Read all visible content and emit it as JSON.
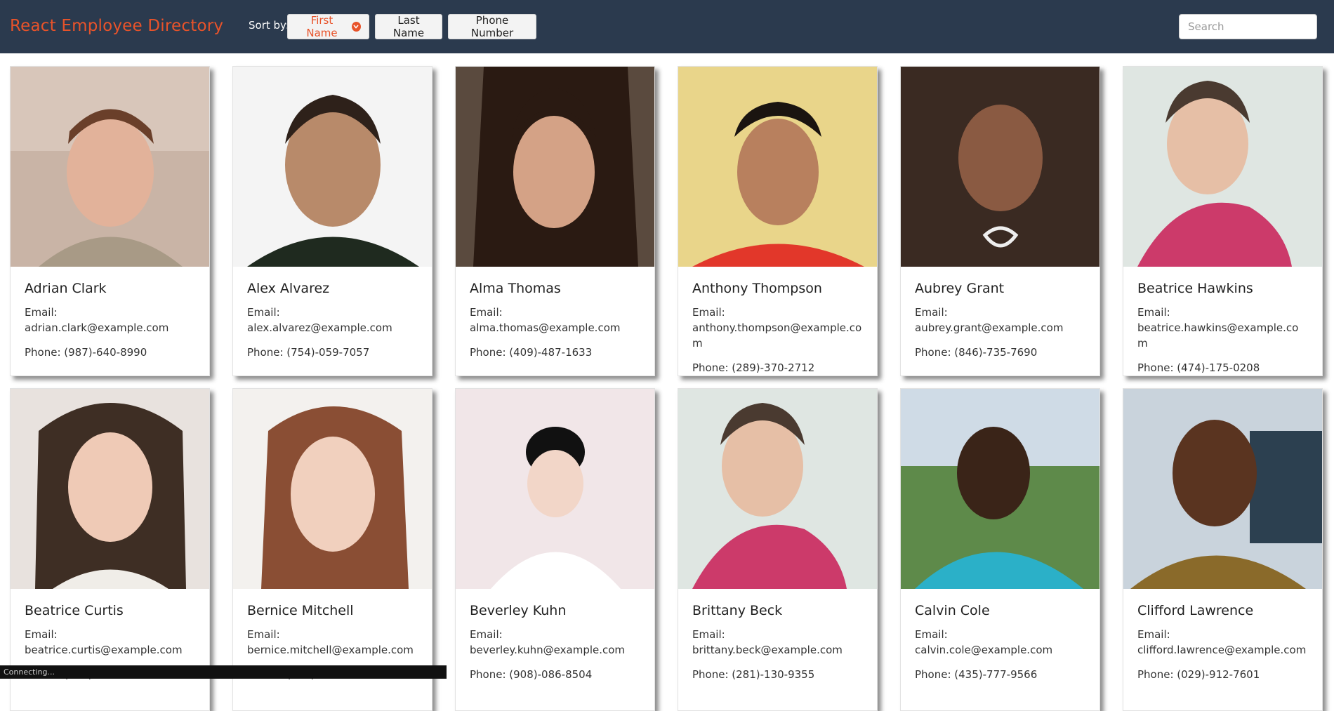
{
  "app": {
    "title": "React Employee Directory"
  },
  "sort": {
    "label": "Sort by:",
    "options": [
      "First Name",
      "Last Name",
      "Phone Number"
    ],
    "active": "First Name"
  },
  "search": {
    "placeholder": "Search",
    "value": ""
  },
  "labels": {
    "email_prefix": "Email:",
    "phone_prefix": "Phone:"
  },
  "colors": {
    "header_bg": "#2b3a4e",
    "accent": "#e8532a"
  },
  "employees": [
    {
      "name": "Adrian Clark",
      "email": "Email: adrian.clark@example.com",
      "phone": "Phone: (987)-640-8990"
    },
    {
      "name": "Alex Alvarez",
      "email": "Email: alex.alvarez@example.com",
      "phone": "Phone: (754)-059-7057"
    },
    {
      "name": "Alma Thomas",
      "email": "Email: alma.thomas@example.com",
      "phone": "Phone: (409)-487-1633"
    },
    {
      "name": "Anthony Thompson",
      "email": "Email: anthony.thompson@example.com",
      "phone": "Phone: (289)-370-2712"
    },
    {
      "name": "Aubrey Grant",
      "email": "Email: aubrey.grant@example.com",
      "phone": "Phone: (846)-735-7690"
    },
    {
      "name": "Beatrice Hawkins",
      "email": "Email: beatrice.hawkins@example.com",
      "phone": "Phone: (474)-175-0208"
    },
    {
      "name": "Beatrice Curtis",
      "email": "Email: beatrice.curtis@example.com",
      "phone": "Phone: (614)-836-6291"
    },
    {
      "name": "Bernice Mitchell",
      "email": "Email: bernice.mitchell@example.com",
      "phone": "Phone: (000)-000-0000"
    },
    {
      "name": "Beverley Kuhn",
      "email": "Email: beverley.kuhn@example.com",
      "phone": "Phone: (908)-086-8504"
    },
    {
      "name": "Brittany Beck",
      "email": "Email: brittany.beck@example.com",
      "phone": "Phone: (281)-130-9355"
    },
    {
      "name": "Calvin Cole",
      "email": "Email: calvin.cole@example.com",
      "phone": "Phone: (435)-777-9566"
    },
    {
      "name": "Clifford Lawrence",
      "email": "Email: clifford.lawrence@example.com",
      "phone": "Phone: (029)-912-7601"
    }
  ],
  "status": {
    "text": "Connecting..."
  }
}
